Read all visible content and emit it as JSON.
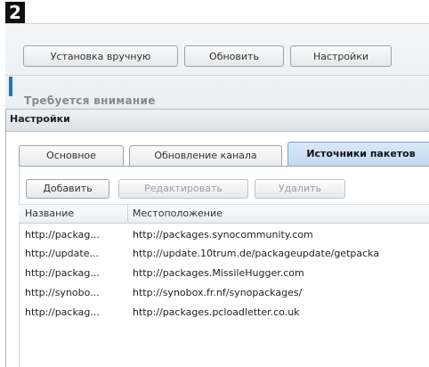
{
  "step_number": "2",
  "background_window": {
    "buttons": [
      "Установка вручную",
      "Обновить",
      "Настройки"
    ],
    "attention_label": "Требуется внимание"
  },
  "dialog": {
    "title": "Настройки",
    "tabs": [
      {
        "label": "Основное",
        "active": false
      },
      {
        "label": "Обновление канала",
        "active": false
      },
      {
        "label": "Источники пакетов",
        "active": true
      }
    ],
    "toolbar": {
      "add_label": "Добавить",
      "edit_label": "Редактировать",
      "delete_label": "Удалить"
    },
    "table": {
      "columns": [
        "Название",
        "Местоположение"
      ],
      "rows": [
        {
          "name": "http://packag...",
          "location": "http://packages.synocommunity.com"
        },
        {
          "name": "http://update...",
          "location": "http://update.10trum.de/packageupdate/getpacka"
        },
        {
          "name": "http://packag...",
          "location": "http://packages.MissileHugger.com"
        },
        {
          "name": "http://synobo...",
          "location": "http://synobox.fr.nf/synopackages/"
        },
        {
          "name": "http://packag...",
          "location": "http://packages.pcloadletter.co.uk"
        }
      ]
    }
  }
}
